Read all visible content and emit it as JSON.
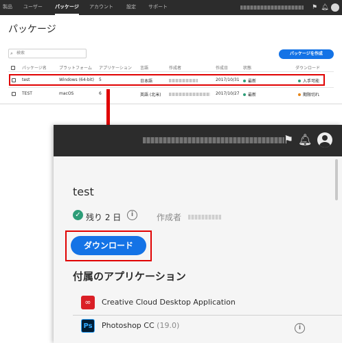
{
  "top_nav": {
    "tabs": [
      "製品",
      "ユーザー",
      "パッケージ",
      "アカウント",
      "設定",
      "サポート"
    ],
    "active_tab": "パッケージ"
  },
  "list_page": {
    "title": "パッケージ",
    "search_placeholder": "検索",
    "create_button": "パッケージを作成",
    "columns": [
      "パッケージ名",
      "プラットフォーム",
      "アプリケーション",
      "言語",
      "作成者",
      "作成日",
      "状態",
      "ダウンロード"
    ],
    "rows": [
      {
        "name": "test",
        "platform": "Windows (64-bit)",
        "apps": "5",
        "language": "日本語",
        "date": "2017/10/31",
        "status": "最新",
        "download": "入手可能",
        "download_color": "#2d9d78"
      },
      {
        "name": "TEST",
        "platform": "macOS",
        "apps": "6",
        "language": "英語 (北米)",
        "date": "2017/10/27",
        "status": "最新",
        "download": "期限切れ",
        "download_color": "#e68619"
      }
    ],
    "status_color": "#2d9d78"
  },
  "detail_page": {
    "title": "test",
    "remaining": "残り 2 日",
    "creator_label": "作成者",
    "download_button": "ダウンロード",
    "apps_heading": "付属のアプリケーション",
    "apps": [
      {
        "name": "Creative Cloud Desktop Application",
        "version": "",
        "icon": "creative-cloud-icon"
      },
      {
        "name": "Photoshop CC",
        "version": "(19.0)",
        "icon": "photoshop-icon"
      }
    ],
    "ps_icon_text": "Ps"
  },
  "colors": {
    "accent": "#1473e6",
    "highlight": "#e00000",
    "nav_bg": "#2c2c2c"
  }
}
